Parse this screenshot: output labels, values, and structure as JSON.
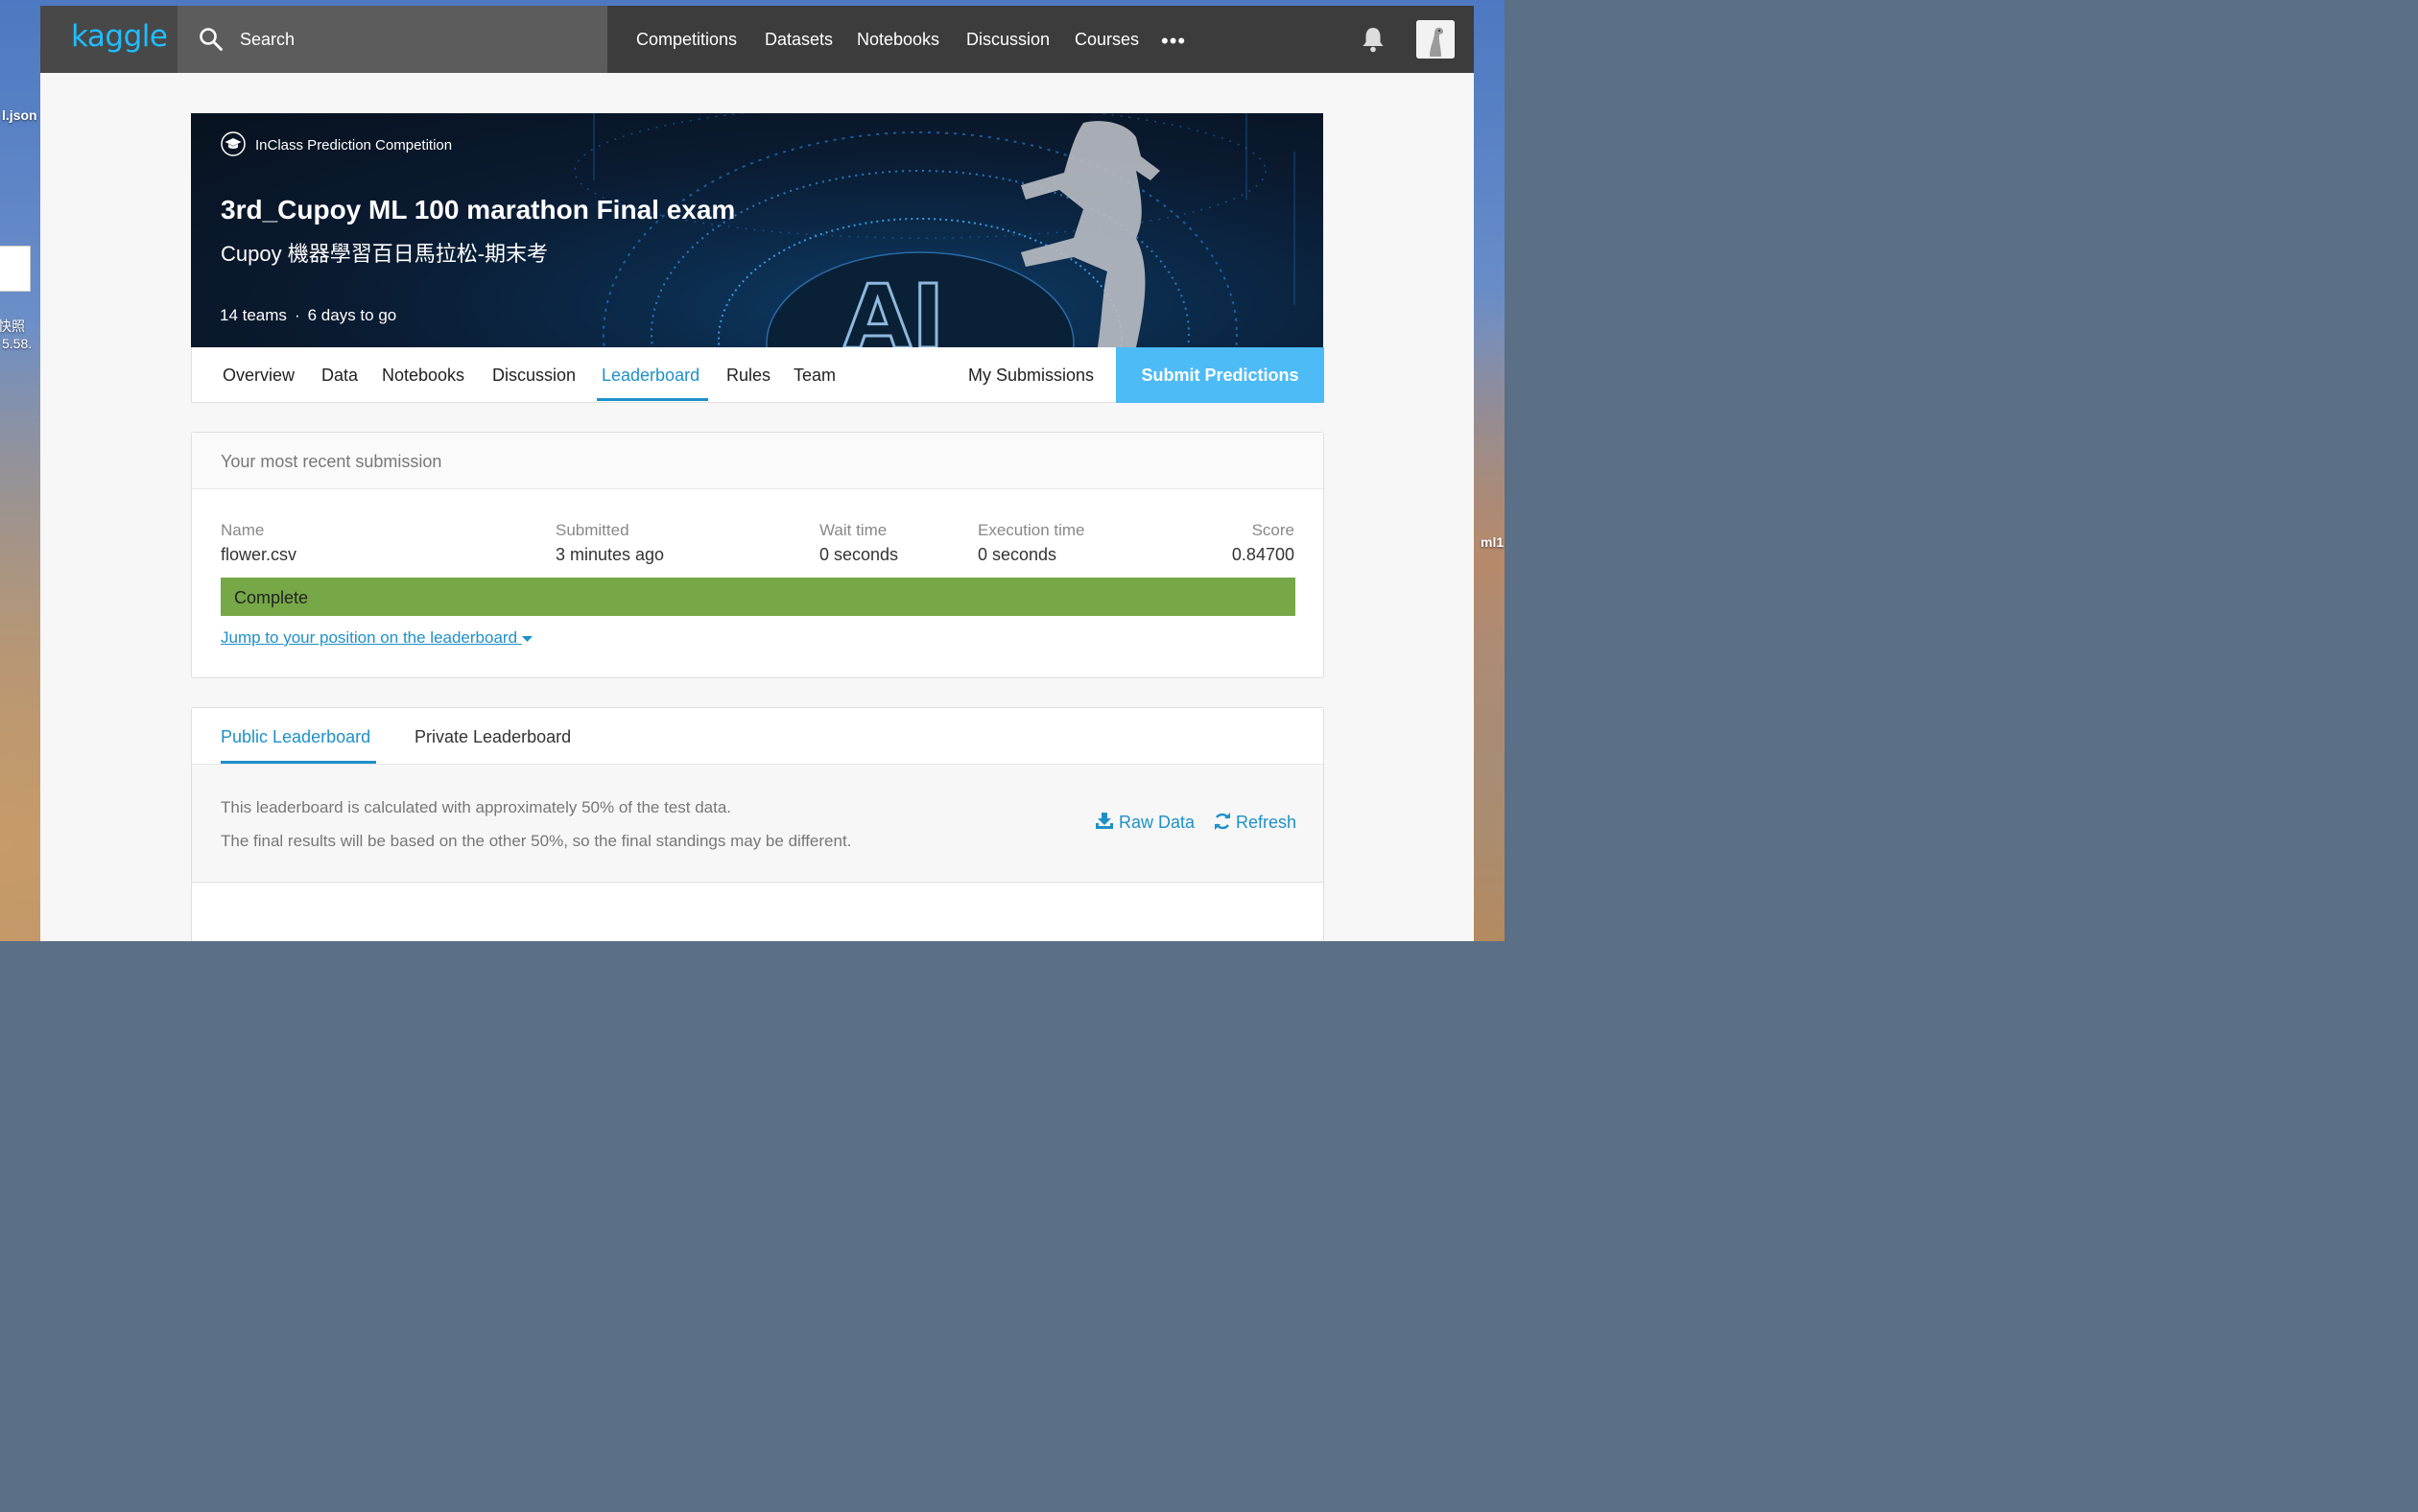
{
  "desktop": {
    "left_labels": [
      "l.json",
      "快照",
      "5.58."
    ],
    "right_label": "ml1"
  },
  "header": {
    "logo": "kaggle",
    "search_placeholder": "Search",
    "nav": [
      "Competitions",
      "Datasets",
      "Notebooks",
      "Discussion",
      "Courses"
    ],
    "more_icon": "more-horizontal-icon",
    "notification_icon": "bell-icon"
  },
  "competition": {
    "type": "InClass Prediction Competition",
    "title": "3rd_Cupoy ML 100 marathon Final exam",
    "subtitle": "Cupoy 機器學習百日馬拉松-期末考",
    "teams": "14 teams",
    "time_left": "6 days to go",
    "banner_text": "AI"
  },
  "tabs": {
    "items": [
      "Overview",
      "Data",
      "Notebooks",
      "Discussion",
      "Leaderboard",
      "Rules",
      "Team"
    ],
    "active": "Leaderboard",
    "my_submissions": "My Submissions",
    "submit": "Submit Predictions"
  },
  "recent_submission": {
    "heading": "Your most recent submission",
    "name_label": "Name",
    "name": "flower.csv",
    "submitted_label": "Submitted",
    "submitted": "3 minutes ago",
    "wait_label": "Wait time",
    "wait": "0 seconds",
    "exec_label": "Execution time",
    "exec": "0 seconds",
    "score_label": "Score",
    "score": "0.84700",
    "status": "Complete",
    "jump_link": "Jump to your position on the leaderboard"
  },
  "leaderboard": {
    "tabs": [
      "Public Leaderboard",
      "Private Leaderboard"
    ],
    "active": "Public Leaderboard",
    "note_line1": "This leaderboard is calculated with approximately 50% of the test data.",
    "note_line2": "The final results will be based on the other 50%, so the final standings may be different.",
    "raw_data": "Raw Data",
    "refresh": "Refresh"
  },
  "colors": {
    "kaggle_blue": "#20beff",
    "link_blue": "#1e90c8",
    "submit_blue": "#4dbbf5",
    "complete_green": "#77a848",
    "header_dark": "#3c3c3c"
  }
}
